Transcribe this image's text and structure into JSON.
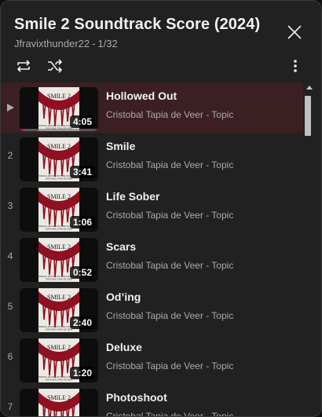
{
  "playlist": {
    "title": "Smile 2 Soundtrack Score (2024)",
    "owner": "Jfravixthunder22",
    "separator": "-",
    "position": "1/32"
  },
  "controls": {
    "loop_icon": "loop-icon",
    "shuffle_icon": "shuffle-icon",
    "more_icon": "more-vert-icon",
    "close_icon": "close-icon"
  },
  "colors": {
    "panel_bg": "#212121",
    "active_row_bg": "#3b1f23",
    "progress_red": "#ff0033",
    "secondary_text": "#aaaaaa"
  },
  "current_track_progress": 0.05,
  "thumbnail": {
    "text_title": "SMILE 2",
    "text_credit": "ORIGINAL MOTION PICTURE SOUNDTRACK",
    "text_composer": "CRISTOBAL TAPIA DE VEER"
  },
  "tracks": [
    {
      "index": "",
      "title": "Hollowed Out",
      "artist": "Cristobal Tapia de Veer - Topic",
      "duration": "4:05",
      "playing": true
    },
    {
      "index": "2",
      "title": "Smile",
      "artist": "Cristobal Tapia de Veer - Topic",
      "duration": "3:41"
    },
    {
      "index": "3",
      "title": "Life Sober",
      "artist": "Cristobal Tapia de Veer - Topic",
      "duration": "1:06"
    },
    {
      "index": "4",
      "title": "Scars",
      "artist": "Cristobal Tapia de Veer - Topic",
      "duration": "0:52"
    },
    {
      "index": "5",
      "title": "Od’ing",
      "artist": "Cristobal Tapia de Veer - Topic",
      "duration": "2:40"
    },
    {
      "index": "6",
      "title": "Deluxe",
      "artist": "Cristobal Tapia de Veer - Topic",
      "duration": "1:20"
    },
    {
      "index": "7",
      "title": "Photoshoot",
      "artist": "Cristobal Tapia de Veer - Topic",
      "duration": ""
    }
  ]
}
